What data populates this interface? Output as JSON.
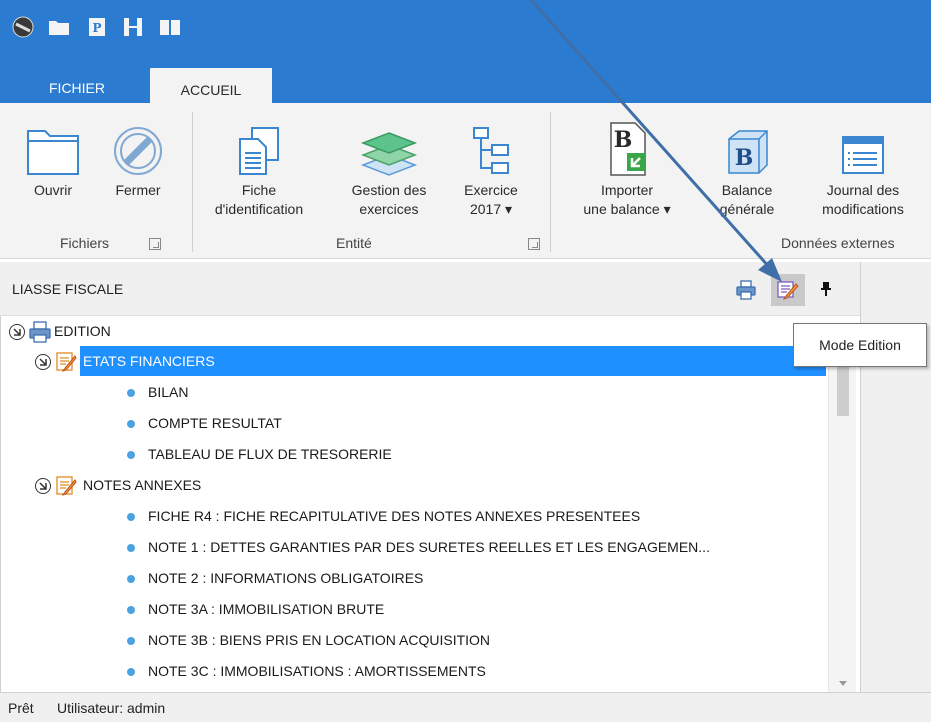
{
  "quick_access": {
    "icons": [
      "app-menu-icon",
      "folder-icon",
      "p-document-icon",
      "split-view-icon",
      "book-icon"
    ]
  },
  "tabs": [
    {
      "label": "FICHIER",
      "active": false
    },
    {
      "label": "ACCUEIL",
      "active": true
    }
  ],
  "ribbon": {
    "buttons": [
      {
        "line1": "Ouvrir",
        "line2": "",
        "icon": "folder-open-icon"
      },
      {
        "line1": "Fermer",
        "line2": "",
        "icon": "no-entry-icon"
      },
      {
        "line1": "Fiche",
        "line2": "d'identification",
        "icon": "document-icon"
      },
      {
        "line1": "Gestion des",
        "line2": "exercices",
        "icon": "layers-icon"
      },
      {
        "line1": "Exercice",
        "line2": "2017 ▾",
        "icon": "hierarchy-icon"
      },
      {
        "line1": "Importer",
        "line2": "une balance ▾",
        "icon": "import-balance-icon"
      },
      {
        "line1": "Balance",
        "line2": "générale",
        "icon": "balance-cube-icon"
      },
      {
        "line1": "Journal des",
        "line2": "modifications",
        "icon": "journal-icon"
      }
    ],
    "groups": [
      {
        "label": "Fichiers"
      },
      {
        "label": "Entité"
      },
      {
        "label": "Données externes"
      }
    ]
  },
  "panel": {
    "title": "LIASSE FISCALE",
    "icons": [
      "print-icon",
      "edit-mode-icon",
      "pin-icon"
    ]
  },
  "tooltip": {
    "text": "Mode Edition"
  },
  "tree": {
    "root": "EDITION",
    "groups": [
      {
        "label": "ETATS FINANCIERS",
        "selected": true,
        "items": [
          "BILAN",
          "COMPTE RESULTAT",
          "TABLEAU DE FLUX DE TRESORERIE"
        ]
      },
      {
        "label": "NOTES ANNEXES",
        "selected": false,
        "items": [
          "FICHE R4 : FICHE RECAPITULATIVE DES NOTES ANNEXES PRESENTEES",
          "NOTE 1 : DETTES GARANTIES PAR DES SURETES REELLES ET LES ENGAGEMEN...",
          "NOTE 2 : INFORMATIONS OBLIGATOIRES",
          "NOTE 3A : IMMOBILISATION BRUTE",
          "NOTE 3B : BIENS PRIS EN LOCATION ACQUISITION",
          "NOTE 3C : IMMOBILISATIONS : AMORTISSEMENTS"
        ]
      }
    ]
  },
  "status": {
    "state": "Prêt",
    "user": "Utilisateur: admin"
  },
  "colors": {
    "titlebar": "#2b7bd0",
    "selection": "#1e90ff",
    "annotation_arrow": "#3f6ea8"
  }
}
